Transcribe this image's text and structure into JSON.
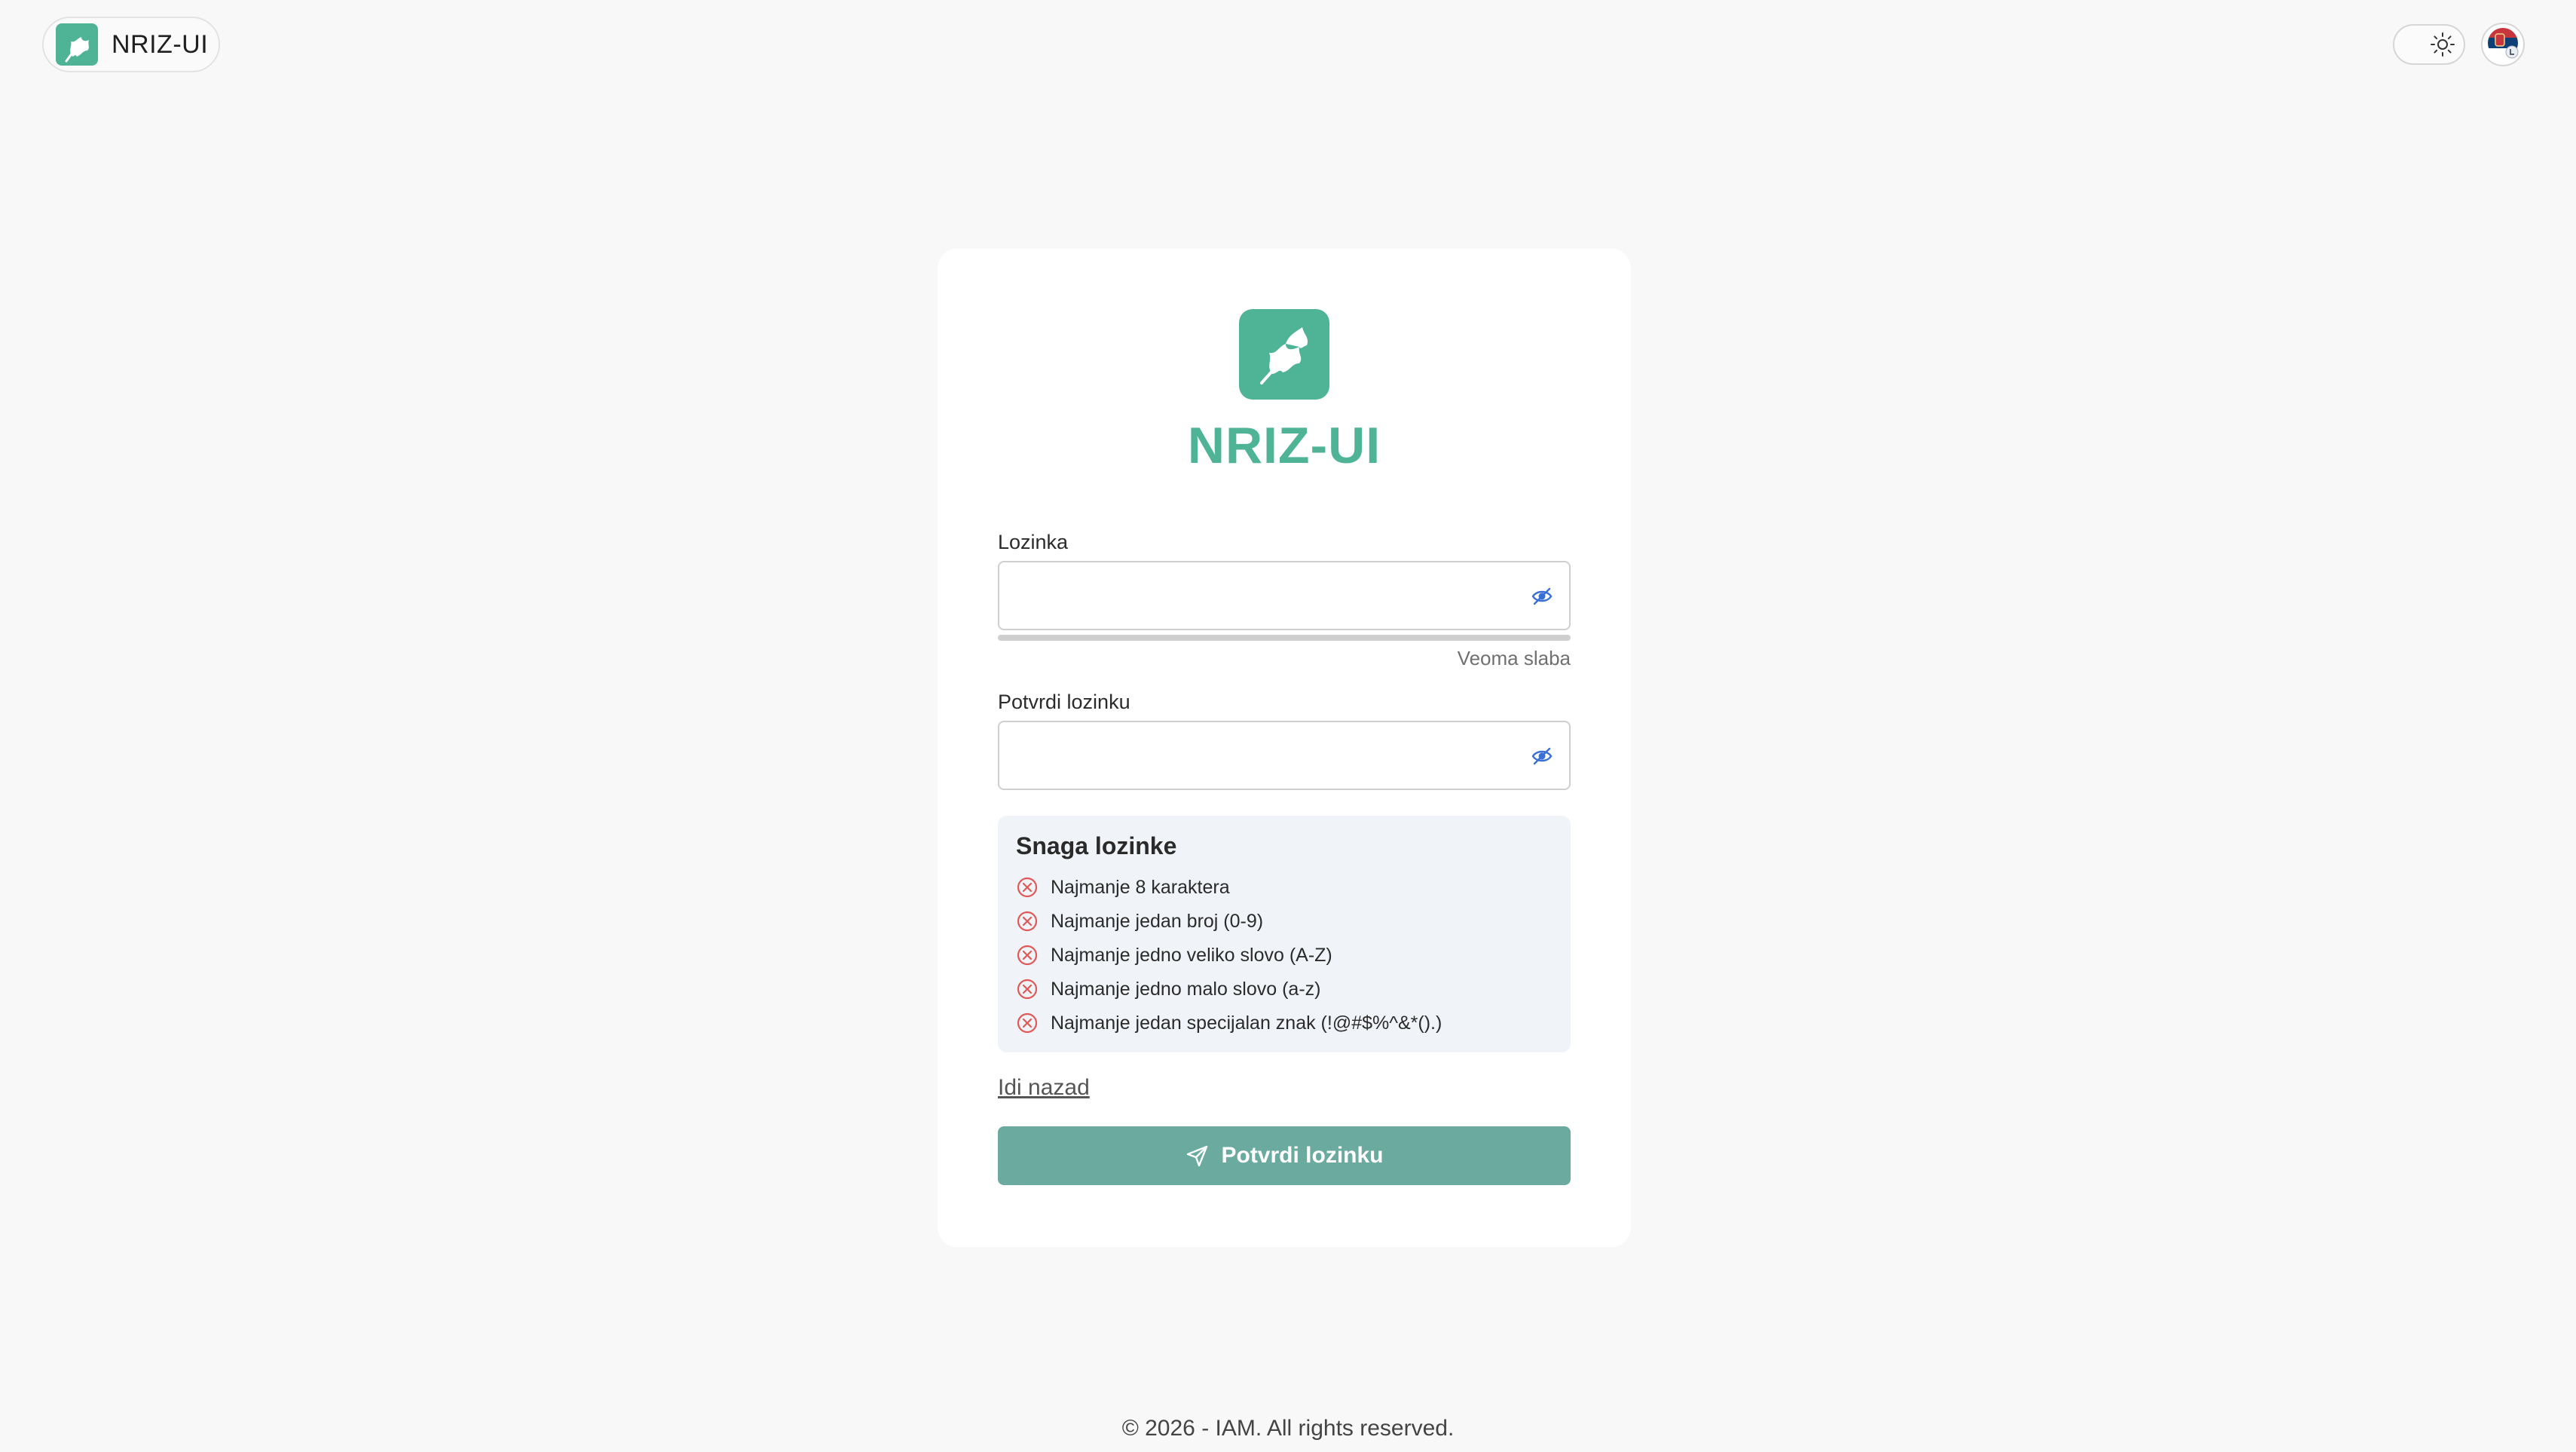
{
  "header": {
    "brand_name": "NRIZ-UI",
    "brand_icon": "oak-leaf-icon",
    "theme_icon": "sun-icon",
    "language_icon": "serbian-flag-icon"
  },
  "card": {
    "app_title": "NRIZ-UI",
    "password_label": "Lozinka",
    "password_value": "",
    "strength_level": 0,
    "strength_text": "Veoma slaba",
    "confirm_label": "Potvrdi lozinku",
    "confirm_value": "",
    "rules": {
      "title": "Snaga lozinke",
      "items": [
        "Najmanje 8 karaktera",
        "Najmanje jedan broj (0-9)",
        "Najmanje jedno veliko slovo (A-Z)",
        "Najmanje jedno malo slovo (a-z)",
        "Najmanje jedan specijalan znak (!@#$%^&*().)"
      ]
    },
    "back_link": "Idi nazad",
    "submit_label": "Potvrdi lozinku"
  },
  "footer": {
    "text": "© 2026 - IAM. All rights reserved."
  },
  "colors": {
    "brand": "#4fb396",
    "button": "#6aaa9f",
    "error": "#e05858",
    "eye": "#3a6fd8"
  }
}
